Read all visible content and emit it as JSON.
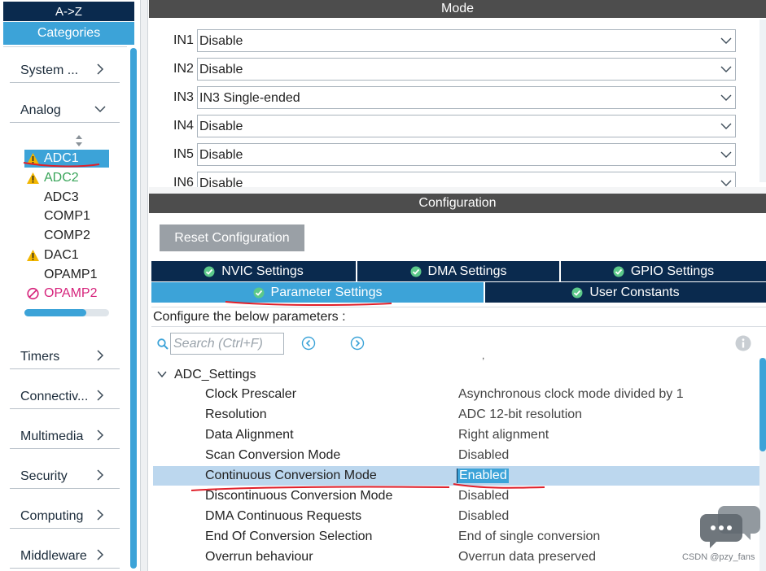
{
  "left_panel": {
    "sort_label": "A->Z",
    "categories_label": "Categories",
    "categories": [
      {
        "label": "System ..."
      },
      {
        "label": "Analog"
      },
      {
        "label": "Timers"
      },
      {
        "label": "Connectiv..."
      },
      {
        "label": "Multimedia"
      },
      {
        "label": "Security"
      },
      {
        "label": "Computing"
      },
      {
        "label": "Middleware"
      }
    ],
    "analog_items": [
      {
        "label": "ADC1",
        "status": "warning",
        "selected": true
      },
      {
        "label": "ADC2",
        "status": "warning",
        "color": "#3aa55a"
      },
      {
        "label": "ADC3",
        "status": "none"
      },
      {
        "label": "COMP1",
        "status": "none"
      },
      {
        "label": "COMP2",
        "status": "none"
      },
      {
        "label": "DAC1",
        "status": "warning"
      },
      {
        "label": "OPAMP1",
        "status": "none"
      },
      {
        "label": "OPAMP2",
        "status": "disabled",
        "color": "#d6247c"
      }
    ]
  },
  "mode": {
    "title": "Mode",
    "inputs": [
      {
        "label": "IN1",
        "value": "Disable"
      },
      {
        "label": "IN2",
        "value": "Disable"
      },
      {
        "label": "IN3",
        "value": "IN3 Single-ended"
      },
      {
        "label": "IN4",
        "value": "Disable"
      },
      {
        "label": "IN5",
        "value": "Disable"
      },
      {
        "label": "IN6",
        "value": "Disable"
      }
    ]
  },
  "configuration": {
    "title": "Configuration",
    "reset_label": "Reset Configuration",
    "tabs_row1": [
      {
        "label": "NVIC Settings"
      },
      {
        "label": "DMA Settings"
      },
      {
        "label": "GPIO Settings"
      }
    ],
    "tabs_row2": [
      {
        "label": "Parameter Settings",
        "active": true
      },
      {
        "label": "User Constants"
      }
    ],
    "configure_text": "Configure the below parameters :",
    "search_placeholder": "Search (Ctrl+F)",
    "dot_mark": ",",
    "group_label": "ADC_Settings",
    "parameters": [
      {
        "name": "Clock Prescaler",
        "value": "Asynchronous clock mode divided by 1"
      },
      {
        "name": "Resolution",
        "value": "ADC 12-bit resolution"
      },
      {
        "name": "Data Alignment",
        "value": "Right alignment"
      },
      {
        "name": "Scan Conversion Mode",
        "value": "Disabled"
      },
      {
        "name": "Continuous Conversion Mode",
        "value": "Enabled",
        "highlighted": true
      },
      {
        "name": "Discontinuous Conversion Mode",
        "value": "Disabled"
      },
      {
        "name": "DMA Continuous Requests",
        "value": "Disabled"
      },
      {
        "name": "End Of Conversion Selection",
        "value": "End of single conversion"
      },
      {
        "name": "Overrun behaviour",
        "value": "Overrun data preserved"
      }
    ]
  },
  "colors": {
    "navy": "#0a2a4e",
    "accent_blue": "#3ca3d8",
    "header_gray": "#4d4d4d",
    "warning_yellow": "#f2b600",
    "annotation_red": "#e0202a"
  },
  "watermark": "CSDN @pzy_fans"
}
